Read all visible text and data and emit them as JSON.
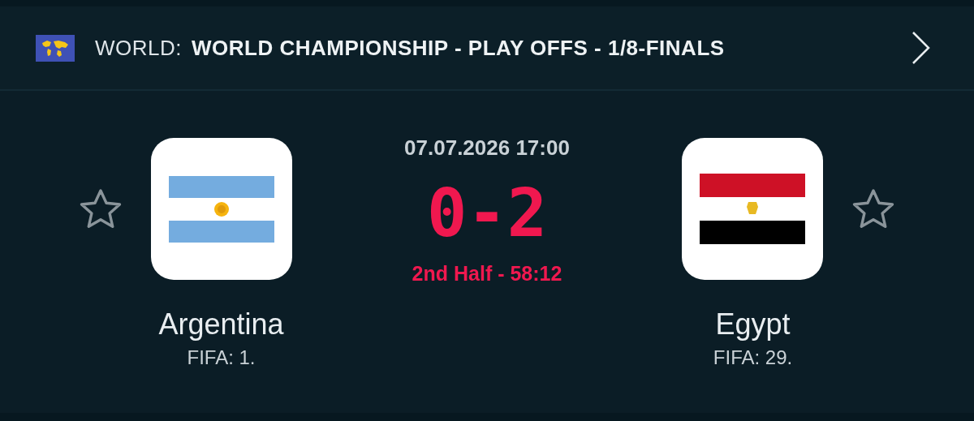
{
  "header": {
    "region": "WORLD:",
    "competition": "WORLD CHAMPIONSHIP - PLAY OFFS - 1/8-FINALS"
  },
  "match": {
    "datetime": "07.07.2026 17:00",
    "score": "0-2",
    "status": "2nd Half - 58:12",
    "live": true
  },
  "teams": [
    {
      "name": "Argentina",
      "ranking": "FIFA: 1.",
      "favorite": false
    },
    {
      "name": "Egypt",
      "ranking": "FIFA: 29.",
      "favorite": false
    }
  ]
}
